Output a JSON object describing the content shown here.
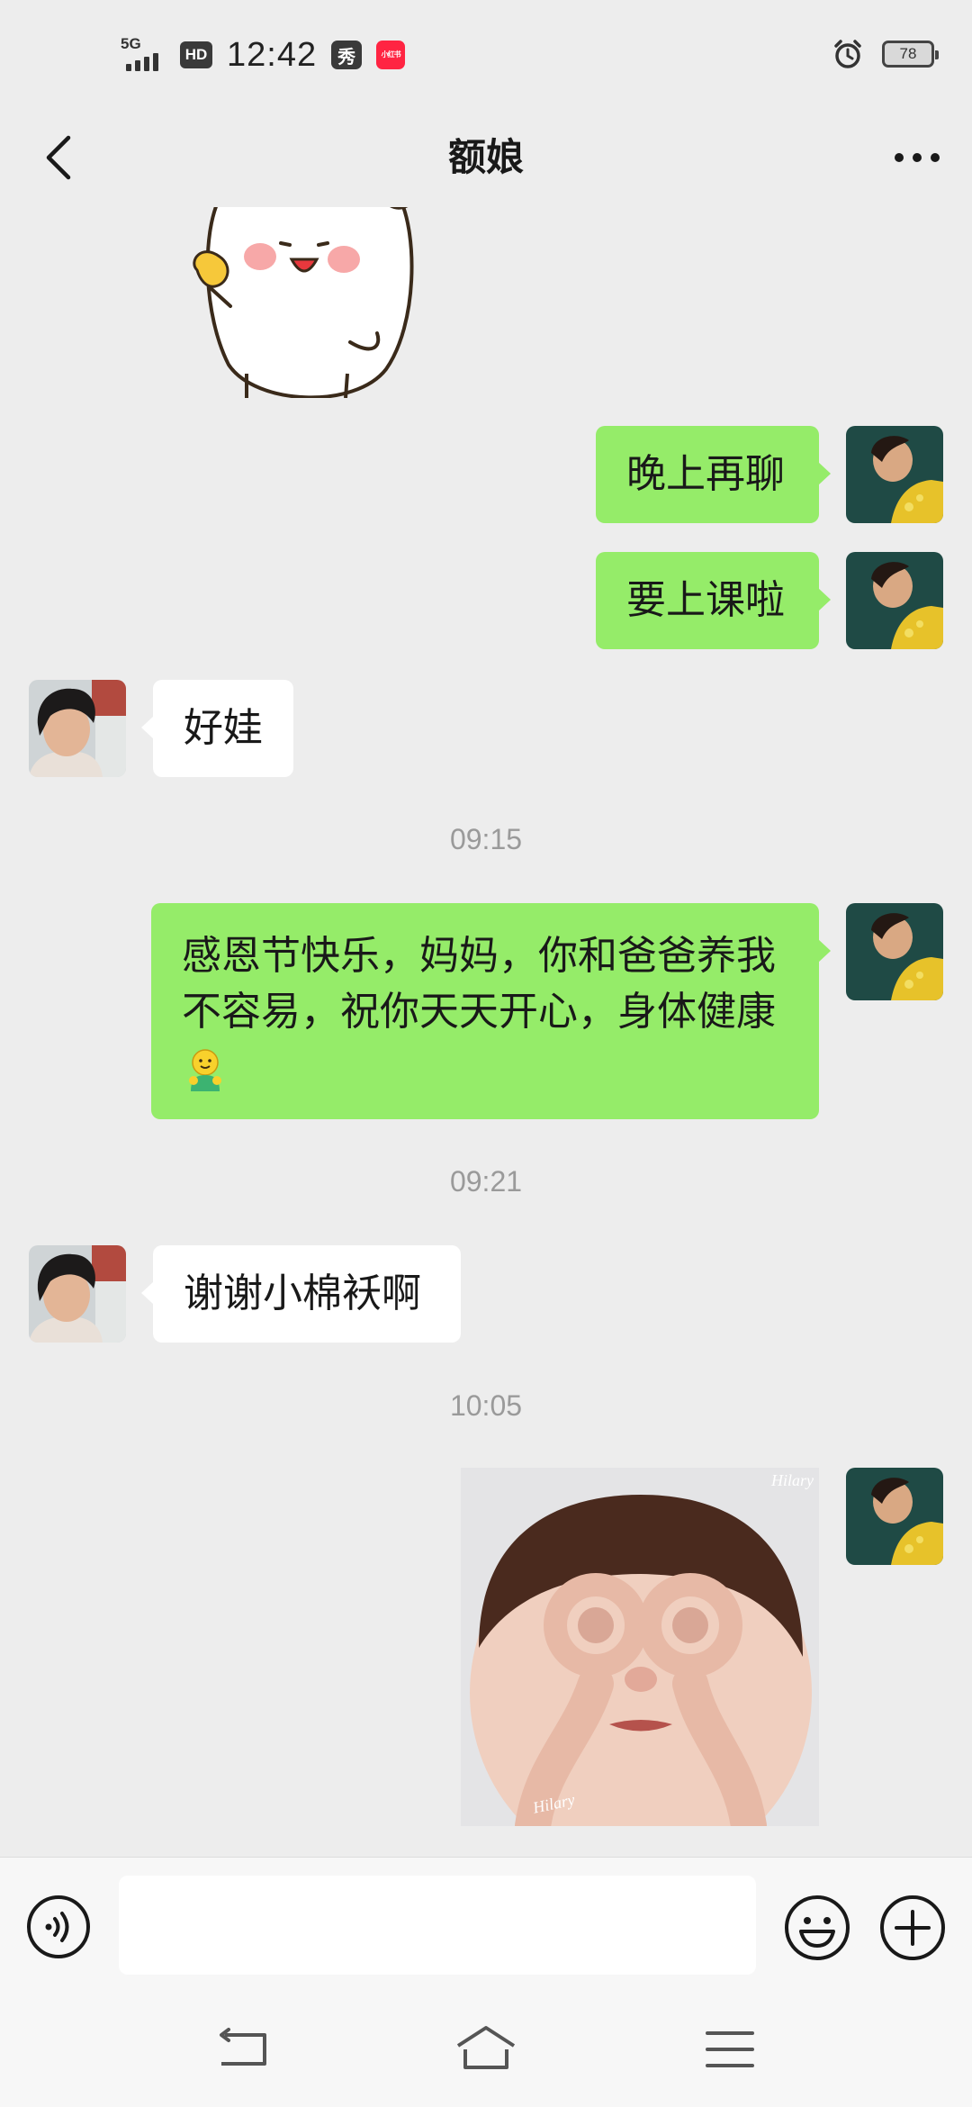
{
  "status_bar": {
    "network": "5G",
    "hd": "HD",
    "time": "12:42",
    "app_badge_1": "秀",
    "app_badge_2": "小红书",
    "battery": "78"
  },
  "header": {
    "title": "额娘"
  },
  "messages": [
    {
      "kind": "sticker",
      "from": "them",
      "description": "white bunny sticker"
    },
    {
      "kind": "text",
      "from": "me",
      "text": "晚上再聊"
    },
    {
      "kind": "text",
      "from": "me",
      "text": "要上课啦"
    },
    {
      "kind": "text",
      "from": "them",
      "text": "好娃"
    },
    {
      "kind": "time",
      "text": "09:15"
    },
    {
      "kind": "text",
      "from": "me",
      "lines": [
        "感恩节快乐，妈妈，你和爸爸养我",
        "不容易，祝你天天开心，身体健康"
      ],
      "emoji": "hugging-face-emoji"
    },
    {
      "kind": "time",
      "text": "09:21"
    },
    {
      "kind": "text",
      "from": "them",
      "text": "谢谢小棉袄啊"
    },
    {
      "kind": "time",
      "text": "10:05"
    },
    {
      "kind": "image",
      "from": "me",
      "watermark_top": "Hilary",
      "watermark_bottom": "Hilary"
    }
  ],
  "input_bar": {
    "value": "",
    "placeholder": ""
  },
  "colors": {
    "background": "#ededed",
    "my_bubble": "#95ec69",
    "their_bubble": "#ffffff",
    "timestamp": "#9a9a9a"
  }
}
